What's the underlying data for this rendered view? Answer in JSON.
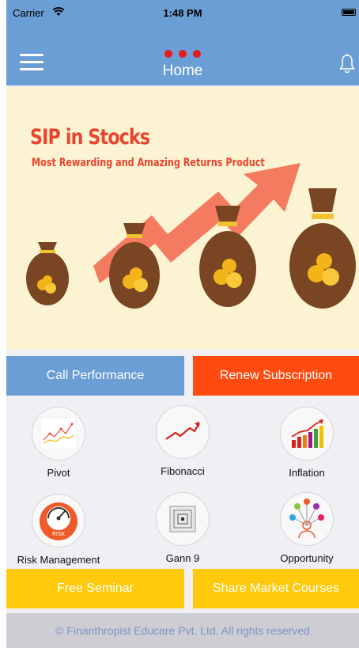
{
  "status_bar": {
    "carrier": "Carrier",
    "time": "1:48 PM"
  },
  "nav": {
    "title": "Home"
  },
  "banner": {
    "title": "SIP in Stocks",
    "subtitle": "Most Rewarding and Amazing Returns Product"
  },
  "buttons": {
    "call_performance": "Call Performance",
    "renew_subscription": "Renew Subscription",
    "free_seminar": "Free Seminar",
    "share_market_courses": "Share Market Courses"
  },
  "tiles": {
    "pivot": "Pivot",
    "fibonacci": "Fibonacci",
    "inflation": "Inflation",
    "risk_management": "Risk Management",
    "gann9": "Gann 9",
    "opportunity": "Opportunity"
  },
  "icon_texts": {
    "risk": "RISK"
  },
  "footer": {
    "text": "© Finanthropist Educare Pvt. Ltd. All rights reserved"
  },
  "colors": {
    "primary_blue": "#6b9ed4",
    "orange": "#ff4b0f",
    "yellow": "#ffc90c",
    "banner_red": "#e8452f"
  }
}
